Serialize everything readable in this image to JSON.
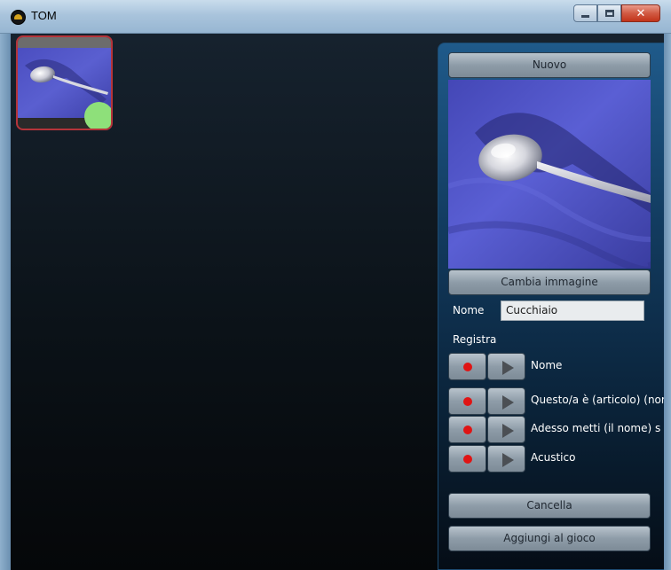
{
  "window": {
    "title": "TOM",
    "icon": "tom-app-icon",
    "buttons": {
      "minimize_icon": "minimize-icon",
      "maximize_icon": "maximize-icon",
      "close_label": "✕"
    }
  },
  "gallery": {
    "items": [
      {
        "image": "spoon-thumbnail",
        "status_color": "#8ee07a",
        "selected": true
      }
    ]
  },
  "panel": {
    "new_button": "Nuovo",
    "preview_image": "spoon-photo",
    "change_image_button": "Cambia immagine",
    "name_label": "Nome",
    "name_value": "Cucchiaio",
    "record_label": "Registra",
    "recordings": [
      {
        "label": "Nome"
      },
      {
        "label": "Questo/a è (articolo) (nome)"
      },
      {
        "label": "Adesso metti (il nome) s"
      },
      {
        "label": "Acustico"
      }
    ],
    "delete_button": "Cancella",
    "add_button": "Aggiungi al gioco"
  },
  "colors": {
    "accent_selection": "#b5343a",
    "status_ok": "#8ee07a",
    "record_red": "#e01414"
  }
}
